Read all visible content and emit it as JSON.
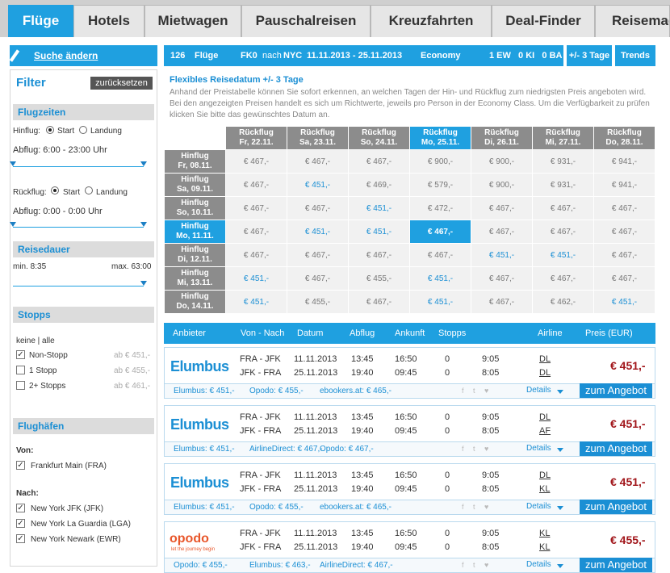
{
  "nav": {
    "tabs": [
      "Flüge",
      "Hotels",
      "Mietwagen",
      "Pauschalreisen",
      "Kreuzfahrten",
      "Deal-Finder",
      "Reisemag"
    ]
  },
  "sidebar": {
    "search_link": "Suche ändern",
    "filter_title": "Filter",
    "reset": "zurücksetzen",
    "flugzeiten": "Flugzeiten",
    "hinflug": "Hinflug:",
    "start": "Start",
    "landung": "Landung",
    "abflug1": "Abflug: 6:00 - 23:00 Uhr",
    "rueckflug": "Rückflug:",
    "abflug2": "Abflug: 0:00 - 0:00 Uhr",
    "reisedauer": "Reisedauer",
    "min": "min. 8:35",
    "max": "max. 63:00",
    "stopps": "Stopps",
    "keine_alle": "keine | alle",
    "stop_options": [
      {
        "label": "Non-Stopp",
        "price": "ab € 451,-",
        "checked": true
      },
      {
        "label": "1 Stopp",
        "price": "ab € 455,-",
        "checked": false
      },
      {
        "label": "2+ Stopps",
        "price": "ab € 461,-",
        "checked": false
      }
    ],
    "flughaefen": "Flughäfen",
    "von": "Von:",
    "von_items": [
      "Frankfurt Main (FRA)"
    ],
    "nach": "Nach:",
    "nach_items": [
      "New York JFK (JFK)",
      "New York La Guardia (LGA)",
      "New York Newark (EWR)"
    ]
  },
  "summary": {
    "count": "126",
    "flights": "Flüge",
    "from": "FK0",
    "nach": "nach",
    "to": "NYC",
    "dates": "11.11.2013 - 25.11.2013",
    "class": "Economy",
    "pax": "1 EW   0 KI   0 BA",
    "btn_days": "+/- 3 Tage",
    "btn_trends": "Trends"
  },
  "info": {
    "title": "Flexibles Reisedatum +/- 3 Tage",
    "text": "Anhand der Preistabelle können Sie sofort erkennen, an welchen Tagen der Hin- und Rückflug zum niedrigsten Preis angeboten wird. Bei den angezeigten Preisen handelt es sich um Richtwerte, jeweils pro Person in der Economy Class. Um die Verfügbarkeit zu prüfen klicken Sie bitte das gewünschtes Datum an."
  },
  "matrix": {
    "col_label": "Rückflug",
    "row_label": "Hinflug",
    "cols": [
      "Fr, 22.11.",
      "Sa, 23.11.",
      "So, 24.11.",
      "Mo, 25.11.",
      "Di, 26.11.",
      "Mi, 27.11.",
      "Do, 28.11."
    ],
    "rows": [
      "Fr, 08.11.",
      "Sa, 09.11.",
      "So, 10.11.",
      "Mo, 11.11.",
      "Di, 12.11.",
      "Mi, 13.11.",
      "Do, 14.11."
    ],
    "values": [
      [
        "€ 467,-",
        "€ 467,-",
        "€ 467,-",
        "€ 900,-",
        "€ 900,-",
        "€ 931,-",
        "€ 941,-"
      ],
      [
        "€ 467,-",
        "€ 451,-",
        "€ 469,-",
        "€ 579,-",
        "€ 900,-",
        "€ 931,-",
        "€ 941,-"
      ],
      [
        "€ 467,-",
        "€ 467,-",
        "€ 451,-",
        "€ 472,-",
        "€ 467,-",
        "€ 467,-",
        "€ 467,-"
      ],
      [
        "€ 467,-",
        "€ 451,-",
        "€ 451,-",
        "€ 467,-",
        "€ 467,-",
        "€ 467,-",
        "€ 467,-"
      ],
      [
        "€ 467,-",
        "€ 467,-",
        "€ 467,-",
        "€ 467,-",
        "€ 451,-",
        "€ 451,-",
        "€ 467,-"
      ],
      [
        "€ 451,-",
        "€ 467,-",
        "€ 455,-",
        "€ 451,-",
        "€ 467,-",
        "€ 467,-",
        "€ 467,-"
      ],
      [
        "€ 451,-",
        "€ 455,-",
        "€ 467,-",
        "€ 451,-",
        "€ 467,-",
        "€ 462,-",
        "€ 451,-"
      ]
    ]
  },
  "results": {
    "headers": [
      "Anbieter",
      "Von - Nach",
      "Datum",
      "Abflug",
      "Ankunft",
      "Stopps",
      "Airline",
      "Preis (EUR)"
    ],
    "details": "Details",
    "cta": "zum Angebot",
    "items": [
      {
        "logo": "Elumbus",
        "logo2": "",
        "legs": [
          [
            "FRA - JFK",
            "11.11.2013",
            "13:45",
            "16:50",
            "0",
            "9:05",
            "DL"
          ],
          [
            "JFK - FRA",
            "25.11.2013",
            "19:40",
            "09:45",
            "0",
            "8:05",
            "DL"
          ]
        ],
        "price": "€ 451,-",
        "offers": [
          "Elumbus: € 451,-",
          "Opodo: € 455,-",
          "ebookers.at: € 465,-"
        ]
      },
      {
        "logo": "Elumbus",
        "logo2": "",
        "legs": [
          [
            "FRA - JFK",
            "11.11.2013",
            "13:45",
            "16:50",
            "0",
            "9:05",
            "DL"
          ],
          [
            "JFK - FRA",
            "25.11.2013",
            "19:40",
            "09:45",
            "0",
            "8:05",
            "AF"
          ]
        ],
        "price": "€ 451,-",
        "offers": [
          "Elumbus: € 451,-",
          "AirlineDirect: € 467,-",
          "Opodo: € 467,-"
        ]
      },
      {
        "logo": "Elumbus",
        "logo2": "",
        "legs": [
          [
            "FRA - JFK",
            "11.11.2013",
            "13:45",
            "16:50",
            "0",
            "9:05",
            "DL"
          ],
          [
            "JFK - FRA",
            "25.11.2013",
            "19:40",
            "09:45",
            "0",
            "8:05",
            "KL"
          ]
        ],
        "price": "€ 451,-",
        "offers": [
          "Elumbus: € 451,-",
          "Opodo: € 455,-",
          "ebookers.at: € 465,-"
        ]
      },
      {
        "logo": "opodo",
        "logo2": "let the journey begin",
        "legs": [
          [
            "FRA - JFK",
            "11.11.2013",
            "13:45",
            "16:50",
            "0",
            "9:05",
            "KL"
          ],
          [
            "JFK - FRA",
            "25.11.2013",
            "19:40",
            "09:45",
            "0",
            "8:05",
            "KL"
          ]
        ],
        "price": "€ 455,-",
        "offers": [
          "Opodo: € 455,-",
          "Elumbus: € 463,-",
          "AirlineDirect: € 467,-"
        ]
      }
    ]
  }
}
